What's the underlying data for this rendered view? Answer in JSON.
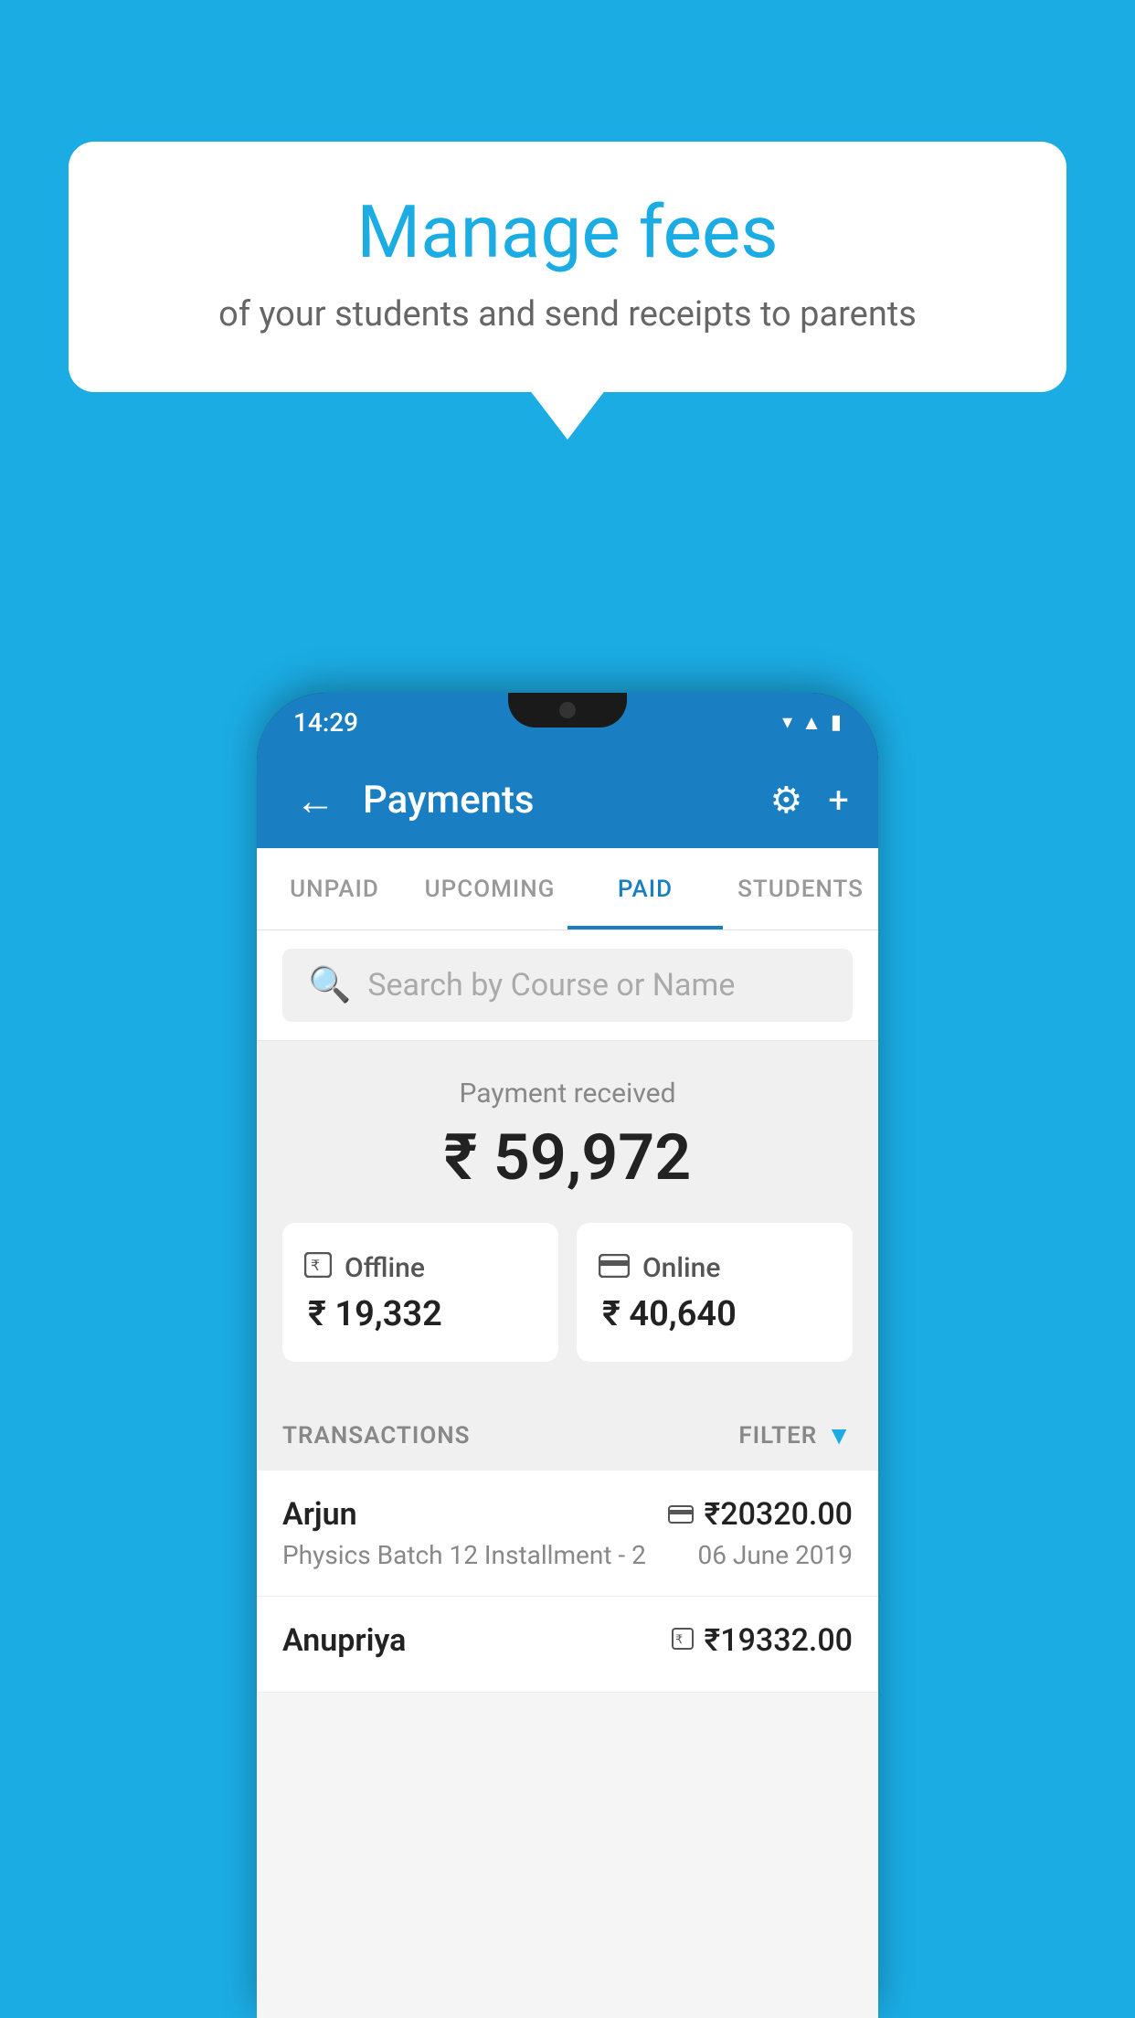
{
  "background": {
    "color": "#1BACE4"
  },
  "bubble": {
    "title": "Manage fees",
    "subtitle": "of your students and send receipts to parents"
  },
  "status_bar": {
    "time": "14:29",
    "icons": [
      "wifi",
      "signal",
      "battery"
    ]
  },
  "app_bar": {
    "title": "Payments",
    "back_label": "←",
    "settings_label": "⚙",
    "add_label": "+"
  },
  "tabs": [
    {
      "label": "UNPAID",
      "active": false
    },
    {
      "label": "UPCOMING",
      "active": false
    },
    {
      "label": "PAID",
      "active": true
    },
    {
      "label": "STUDENTS",
      "active": false
    }
  ],
  "search": {
    "placeholder": "Search by Course or Name"
  },
  "payment_summary": {
    "label": "Payment received",
    "amount": "₹ 59,972",
    "offline": {
      "label": "Offline",
      "amount": "₹ 19,332"
    },
    "online": {
      "label": "Online",
      "amount": "₹ 40,640"
    }
  },
  "transactions": {
    "label": "TRANSACTIONS",
    "filter_label": "FILTER",
    "items": [
      {
        "name": "Arjun",
        "course": "Physics Batch 12 Installment - 2",
        "amount": "₹20320.00",
        "date": "06 June 2019",
        "method": "online"
      },
      {
        "name": "Anupriya",
        "course": "",
        "amount": "₹19332.00",
        "date": "",
        "method": "offline"
      }
    ]
  }
}
